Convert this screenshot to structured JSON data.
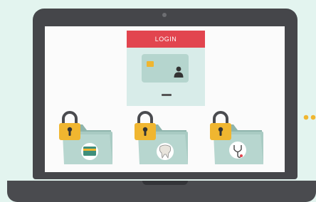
{
  "login": {
    "header_label": "LOGIN"
  },
  "folders": [
    {
      "content_icon": "credit-card-icon"
    },
    {
      "content_icon": "tooth-icon"
    },
    {
      "content_icon": "stethoscope-icon"
    }
  ],
  "colors": {
    "background": "#e3f4ef",
    "laptop": "#45464a",
    "accent_red": "#e2454f",
    "lock_gold": "#f0b630",
    "folder_teal": "#a9cbc3"
  }
}
